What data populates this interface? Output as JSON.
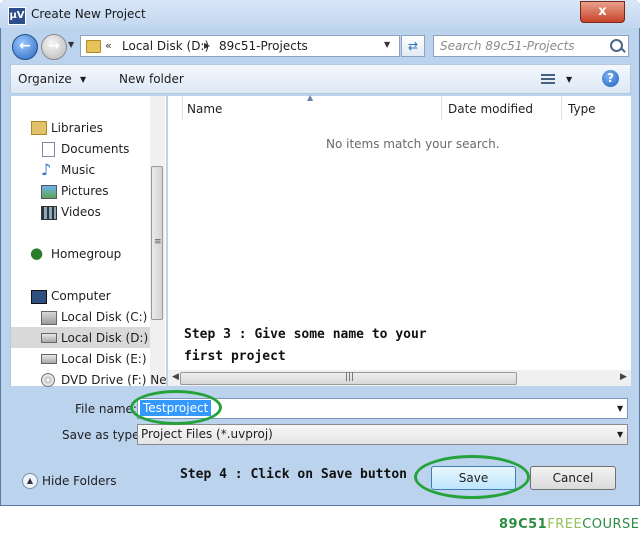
{
  "window": {
    "title": "Create New Project",
    "app_icon": "µV",
    "close_glyph": "x"
  },
  "address": {
    "back_glyph": "←",
    "forward_glyph": "→",
    "overflow": "«",
    "crumbs": [
      "Local Disk (D:)",
      "89c51-Projects"
    ],
    "separator": "▸",
    "refresh_glyph": "⇄",
    "search_placeholder": "Search 89c51-Projects"
  },
  "toolbar": {
    "organize": "Organize",
    "new_folder": "New folder",
    "help": "?"
  },
  "nav": {
    "groups": [
      {
        "label": "Libraries",
        "icon": "libraries-icon",
        "items": [
          "Documents",
          "Music",
          "Pictures",
          "Videos"
        ]
      },
      {
        "label": "Homegroup",
        "icon": "homegroup-icon",
        "items": []
      },
      {
        "label": "Computer",
        "icon": "computer-icon",
        "items": [
          "Local Disk (C:)",
          "Local Disk (D:)",
          "Local Disk (E:)",
          "DVD Drive (F:) Ne"
        ]
      }
    ],
    "selected": "Local Disk (D:)"
  },
  "columns": [
    "Name",
    "Date modified",
    "Type"
  ],
  "empty_message": "No items match your search.",
  "annotations": {
    "step3_line1": "Step 3 : Give some name to your",
    "step3_line2": "first project",
    "step4": "Step 4 : Click on Save button"
  },
  "form": {
    "file_name_label": "File name:",
    "file_name_value": "Testproject",
    "save_as_label": "Save as type:",
    "save_as_value": "Project Files (*.uvproj)"
  },
  "footer": {
    "hide_folders": "Hide Folders",
    "hide_glyph": "▲",
    "save": "Save",
    "cancel": "Cancel"
  },
  "watermark": {
    "part1": "89C51",
    "part2": "FREE",
    "part3": "COURSE"
  },
  "colors": {
    "highlight_ring": "#25a33b",
    "selection": "#3399ff"
  }
}
